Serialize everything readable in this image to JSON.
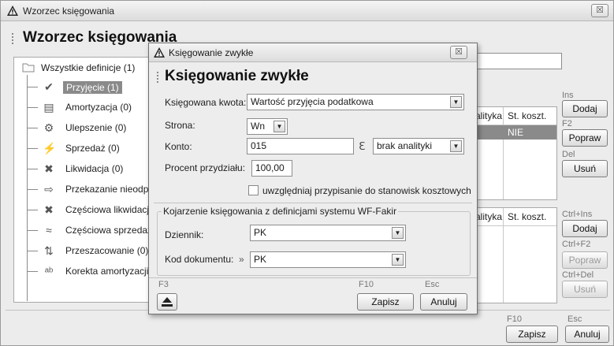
{
  "window": {
    "title": "Wzorzec księgowania",
    "heading": "Wzorzec księgowania",
    "close_label": "☒"
  },
  "tree": {
    "root": "Wszystkie definicje (1)",
    "items": [
      {
        "label": "Przyjęcie (1)",
        "icon": "check-icon",
        "glyph": "✔",
        "selected": true
      },
      {
        "label": "Amortyzacja (0)",
        "icon": "document-icon",
        "glyph": "▤"
      },
      {
        "label": "Ulepszenie (0)",
        "icon": "gears-icon",
        "glyph": "⚙"
      },
      {
        "label": "Sprzedaż (0)",
        "icon": "sale-icon",
        "glyph": "⚡"
      },
      {
        "label": "Likwidacja (0)",
        "icon": "cross-icon",
        "glyph": "✖"
      },
      {
        "label": "Przekazanie nieodpł",
        "icon": "transfer-icon",
        "glyph": "⇨"
      },
      {
        "label": "Częściowa likwidacja",
        "icon": "partial-cross-icon",
        "glyph": "✖"
      },
      {
        "label": "Częściowa sprzedaż",
        "icon": "partial-sale-icon",
        "glyph": "≈"
      },
      {
        "label": "Przeszacowanie (0)",
        "icon": "revaluation-icon",
        "glyph": "⇅"
      },
      {
        "label": "Korekta amortyzacji",
        "icon": "ab-ac-icon",
        "glyph": "ᵃᵇ"
      }
    ]
  },
  "upper_grid": {
    "col_analityka": "alityka",
    "col_st_koszt": "St. koszt.",
    "row_value_st": "NIE"
  },
  "lower_grid": {
    "col_analityka": "alityka",
    "col_st_koszt": "St. koszt."
  },
  "side_buttons_upper": {
    "ins_key": "Ins",
    "add": "Dodaj",
    "f2_key": "F2",
    "edit": "Popraw",
    "del_key": "Del",
    "remove": "Usuń"
  },
  "side_buttons_lower": {
    "ins_key": "Ctrl+Ins",
    "add": "Dodaj",
    "f2_key": "Ctrl+F2",
    "edit": "Popraw",
    "del_key": "Ctrl+Del",
    "remove": "Usuń"
  },
  "main_footer": {
    "f10_key": "F10",
    "save": "Zapisz",
    "esc_key": "Esc",
    "cancel": "Anuluj"
  },
  "dialog": {
    "title": "Księgowanie zwykłe",
    "heading": "Księgowanie zwykłe",
    "close_label": "☒",
    "kwota_label": "Księgowana kwota:",
    "kwota_value": "Wartość przyjęcia podatkowa",
    "strona_label": "Strona:",
    "strona_value": "Wn",
    "konto_label": "Konto:",
    "konto_value": "015",
    "analityka_value": "brak analityki",
    "procent_label": "Procent przydziału:",
    "procent_value": "100,00",
    "checkbox_label": "uwzględniaj przypisanie do stanowisk kosztowych",
    "group_title": "Kojarzenie księgowania z definicjami systemu WF-Fakir",
    "dziennik_label": "Dziennik:",
    "dziennik_value": "PK",
    "kod_label": "Kod dokumentu:",
    "kod_marker": "»",
    "kod_value": "PK",
    "f3_key": "F3",
    "f10_key": "F10",
    "esc_key": "Esc",
    "save": "Zapisz",
    "cancel": "Anuluj"
  }
}
